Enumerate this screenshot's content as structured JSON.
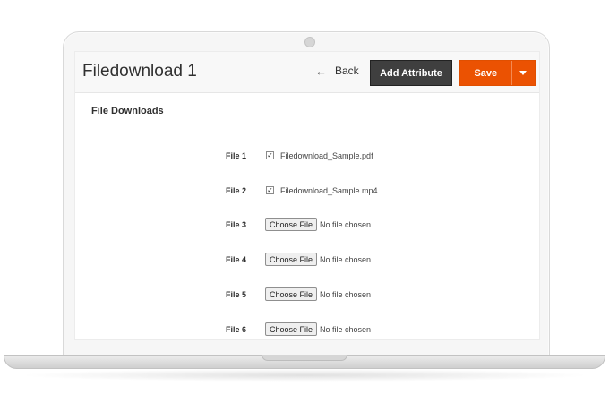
{
  "header": {
    "title": "Filedownload 1",
    "back_label": "Back",
    "back_icon": "←",
    "add_attribute_label": "Add Attribute",
    "save_label": "Save"
  },
  "section": {
    "title": "File Downloads"
  },
  "files": [
    {
      "label": "File 1",
      "type": "checked",
      "name": "Filedownload_Sample.pdf"
    },
    {
      "label": "File 2",
      "type": "checked",
      "name": "Filedownload_Sample.mp4"
    },
    {
      "label": "File 3",
      "type": "empty",
      "button": "Choose File",
      "status": "No file chosen"
    },
    {
      "label": "File 4",
      "type": "empty",
      "button": "Choose File",
      "status": "No file chosen"
    },
    {
      "label": "File 5",
      "type": "empty",
      "button": "Choose File",
      "status": "No file chosen"
    },
    {
      "label": "File 6",
      "type": "empty",
      "button": "Choose File",
      "status": "No file chosen"
    }
  ],
  "colors": {
    "save": "#eb5202",
    "add_attribute": "#3f3f3f"
  }
}
